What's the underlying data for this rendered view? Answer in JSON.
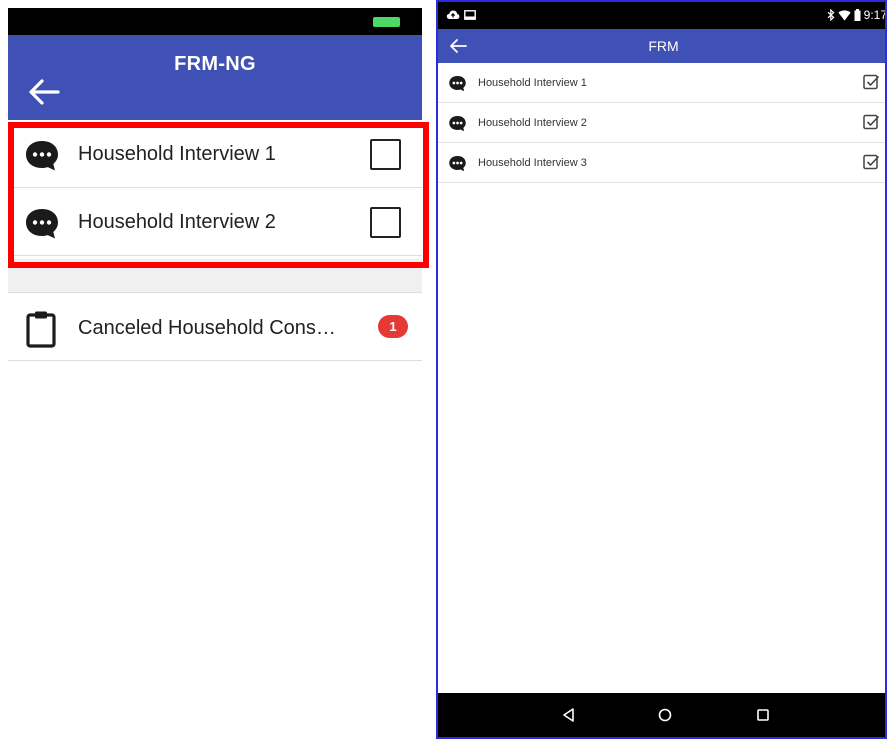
{
  "left": {
    "title": "FRM-NG",
    "items": [
      {
        "label": "Household Interview 1",
        "icon": "chat-bubble-icon",
        "checked": false
      },
      {
        "label": "Household Interview 2",
        "icon": "chat-bubble-icon",
        "checked": false
      }
    ],
    "canceled": {
      "label": "Canceled Household Cons…",
      "icon": "clipboard-icon",
      "badge": "1"
    },
    "colors": {
      "appbar": "#3f51b5",
      "highlight": "#ff0000",
      "badge": "#e53935",
      "battery": "#4cd964"
    }
  },
  "right": {
    "title": "FRM",
    "status_time": "9:17",
    "items": [
      {
        "label": "Household Interview 1",
        "icon": "chat-bubble-icon",
        "checked": true
      },
      {
        "label": "Household Interview 2",
        "icon": "chat-bubble-icon",
        "checked": true
      },
      {
        "label": "Household Interview 3",
        "icon": "chat-bubble-icon",
        "checked": true
      }
    ],
    "navbar": [
      "back-triangle-icon",
      "home-circle-icon",
      "recents-square-icon"
    ],
    "colors": {
      "appbar": "#3f51b5",
      "frame": "#2b2be0"
    }
  }
}
